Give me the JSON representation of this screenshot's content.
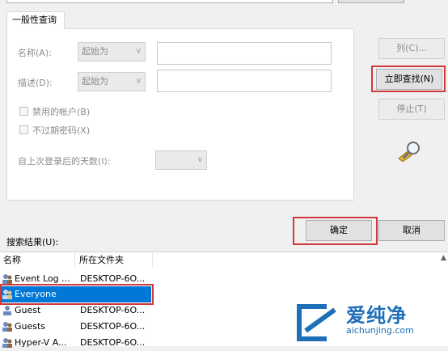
{
  "tab": {
    "label": "一般性查询"
  },
  "fields": {
    "name_label": "名称(A):",
    "name_mode": "起始为",
    "desc_label": "描述(D):",
    "desc_mode": "起始为",
    "disabled_accounts": "禁用的帐户(B)",
    "non_expiring_pw": "不过期密码(X)",
    "days_label": "自上次登录后的天数(I):"
  },
  "buttons": {
    "columns": "列(C)...",
    "find_now": "立即查找(N)",
    "stop": "停止(T)",
    "ok": "确定",
    "cancel": "取消"
  },
  "results": {
    "label": "搜索结果(U):",
    "columns": [
      "名称",
      "所在文件夹"
    ],
    "rows": [
      {
        "name": "Event Log ...",
        "folder": "DESKTOP-6O..."
      },
      {
        "name": "Everyone",
        "folder": "DESKTOP-6O..."
      },
      {
        "name": "Guest",
        "folder": "DESKTOP-6O..."
      },
      {
        "name": "Guests",
        "folder": "DESKTOP-6O..."
      },
      {
        "name": "Hyper-V A...",
        "folder": "DESKTOP-6O..."
      }
    ],
    "selected_index": 1
  },
  "watermark": {
    "brand": "爱纯净",
    "url": "aichunjing.com"
  },
  "colors": {
    "highlight": "#d0393a",
    "selection": "#0078d7",
    "watermark": "#1e6fb8"
  }
}
